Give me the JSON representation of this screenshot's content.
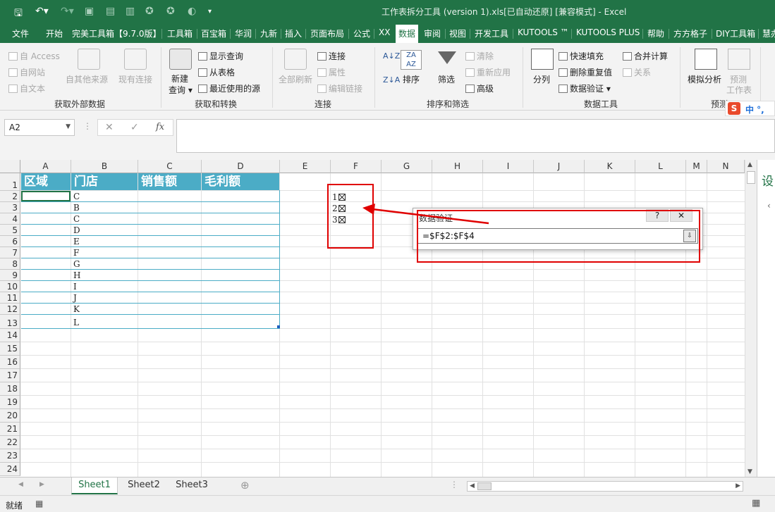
{
  "titlebar": {
    "title": "工作表拆分工具 (version 1).xls[已自动还原] [兼容模式] - Excel"
  },
  "tabs": [
    "文件",
    "开始",
    "完美工具箱【9.7.0版】",
    "工具箱",
    "百宝箱",
    "华润",
    "九新",
    "插入",
    "页面布局",
    "公式",
    "XX",
    "数据",
    "审阅",
    "视图",
    "开发工具",
    "KUTOOLS ™",
    "KUTOOLS PLUS",
    "帮助",
    "方方格子",
    "DIY工具箱",
    "慧办"
  ],
  "active_tab": "数据",
  "ribbon": {
    "get_external": {
      "label": "获取外部数据",
      "from_access": "自 Access",
      "from_web": "自网站",
      "from_text": "自文本",
      "from_other": "自其他来源",
      "existing": "现有连接"
    },
    "get_transform": {
      "label": "获取和转换",
      "new_query_1": "新建",
      "new_query_2": "查询",
      "show_query": "显示查询",
      "from_table": "从表格",
      "recent_sources": "最近使用的源"
    },
    "connections": {
      "label": "连接",
      "refresh_all": "全部刷新",
      "connections": "连接",
      "properties": "属性",
      "edit_links": "编辑链接"
    },
    "sort_filter": {
      "label": "排序和筛选",
      "sort": "排序",
      "filter": "筛选",
      "clear": "清除",
      "reapply": "重新应用",
      "advanced": "高级"
    },
    "data_tools": {
      "label": "数据工具",
      "split": "分列",
      "flash_fill": "快速填充",
      "remove_dup": "删除重复值",
      "validation": "数据验证",
      "consolidate": "合并计算",
      "relations": "关系"
    },
    "forecast": {
      "label": "预测",
      "what_if": "模拟分析",
      "forecast_1": "预测",
      "forecast_2": "工作表"
    }
  },
  "ime": "中 °,",
  "formula_bar": {
    "name_box": "A2",
    "fx": "fx",
    "value": ""
  },
  "columns": [
    "A",
    "B",
    "C",
    "D",
    "E",
    "F",
    "G",
    "H",
    "I",
    "J",
    "K",
    "L",
    "M",
    "N"
  ],
  "rows": [
    "1",
    "2",
    "3",
    "4",
    "5",
    "6",
    "7",
    "8",
    "9",
    "10",
    "11",
    "12",
    "13",
    "14",
    "15",
    "16",
    "17",
    "18",
    "19",
    "20",
    "21",
    "22",
    "23",
    "24"
  ],
  "table_headers": [
    "区域",
    "门店",
    "销售额",
    "毛利额"
  ],
  "col_b_values": [
    "C",
    "B",
    "C",
    "D",
    "E",
    "F",
    "G",
    "H",
    "I",
    "J",
    "K",
    "L"
  ],
  "col_f_values": [
    "1",
    "2",
    "3"
  ],
  "dialog": {
    "title": "数据验证",
    "help": "?",
    "close": "✕",
    "formula": "=$F$2:$F$4"
  },
  "right_pane_char": "设",
  "sheets": [
    "Sheet1",
    "Sheet2",
    "Sheet3"
  ],
  "status": "就绪"
}
